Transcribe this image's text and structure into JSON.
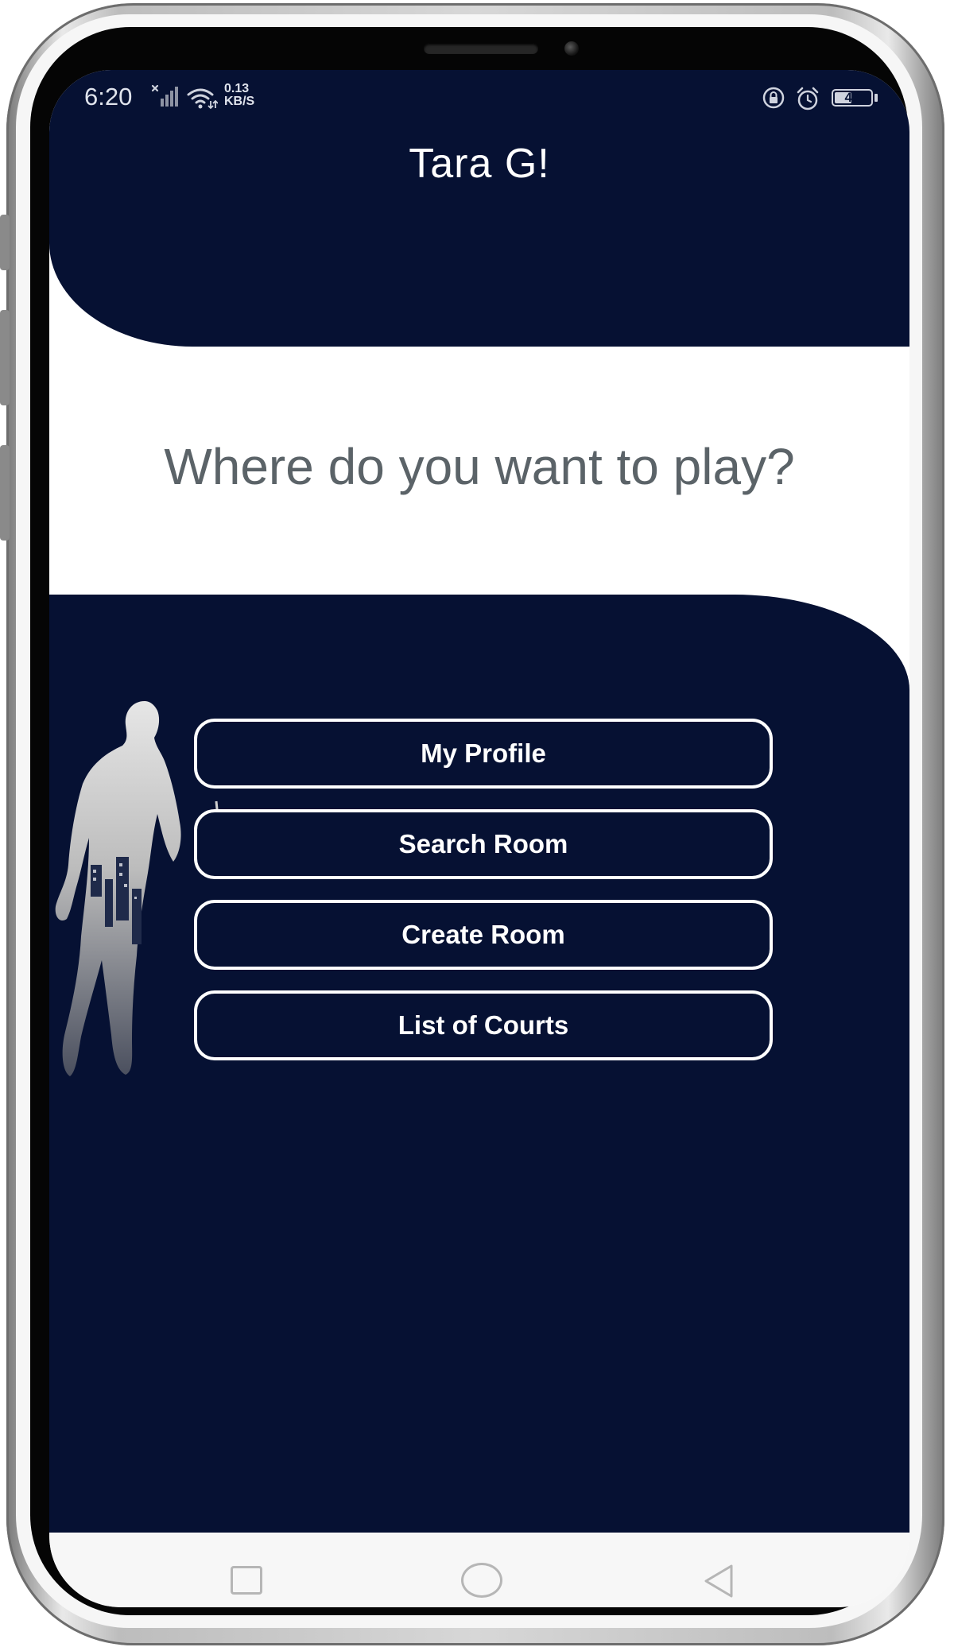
{
  "status_bar": {
    "time": "6:20",
    "net_speed_value": "0.13",
    "net_speed_unit": "KB/S",
    "battery_level": "47",
    "battery_fraction": 0.47
  },
  "header": {
    "title": "Tara G!"
  },
  "main": {
    "prompt": "Where do you want to play?"
  },
  "menu": {
    "items": [
      {
        "label": "My Profile"
      },
      {
        "label": "Search Room"
      },
      {
        "label": "Create Room"
      },
      {
        "label": "List of Courts"
      }
    ]
  },
  "colors": {
    "primary": "#061133",
    "prompt_text": "#5b6368",
    "button_text": "#ffffff"
  },
  "icons": {
    "signal": "signal-icon",
    "wifi": "wifi-icon",
    "lock": "lock-rotation-icon",
    "alarm": "alarm-icon",
    "recents": "recents-icon",
    "home": "home-icon",
    "back": "back-icon"
  }
}
